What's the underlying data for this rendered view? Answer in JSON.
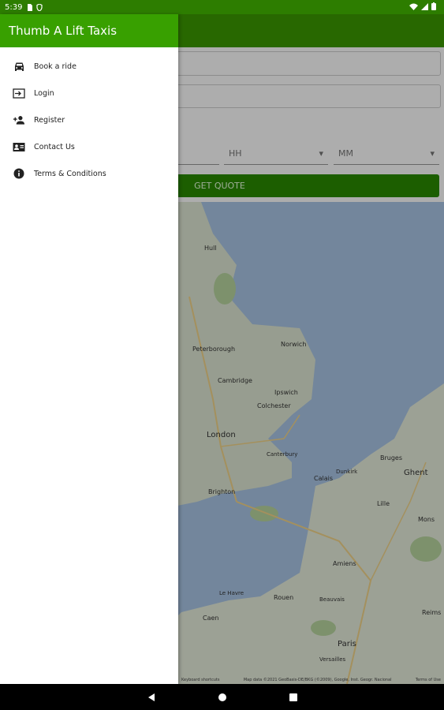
{
  "status_bar": {
    "time": "5:39"
  },
  "under": {
    "hour_placeholder": "HH",
    "minute_placeholder": "MM",
    "quote_button": "GET QUOTE",
    "map_labels": [
      "Hull",
      "Peterborough",
      "Norwich",
      "Cambridge",
      "Ipswich",
      "Colchester",
      "London",
      "Canterbury",
      "Brighton",
      "Calais",
      "Bruges",
      "Ghent",
      "Lille",
      "Amiens",
      "Rouen",
      "Le Havre",
      "Caen",
      "Paris",
      "Versailles",
      "Mons",
      "Reims",
      "Beauvais",
      "Dunkirk"
    ],
    "map_attribution": "Map data ©2021 GeoBasis-DE/BKG (©2009), Google, Inst. Geogr. Nacional",
    "map_terms": "Terms of Use",
    "map_shortcuts": "Keyboard shortcuts"
  },
  "drawer": {
    "title": "Thumb A Lift Taxis",
    "items": [
      {
        "label": "Book a ride",
        "icon": "car-icon"
      },
      {
        "label": "Login",
        "icon": "login-icon"
      },
      {
        "label": "Register",
        "icon": "person-add-icon"
      },
      {
        "label": "Contact Us",
        "icon": "contact-card-icon"
      },
      {
        "label": "Terms & Conditions",
        "icon": "info-icon"
      }
    ]
  },
  "colors": {
    "primary": "#38a000",
    "primary_dark": "#2d7d00",
    "accent": "#2a8b00"
  }
}
